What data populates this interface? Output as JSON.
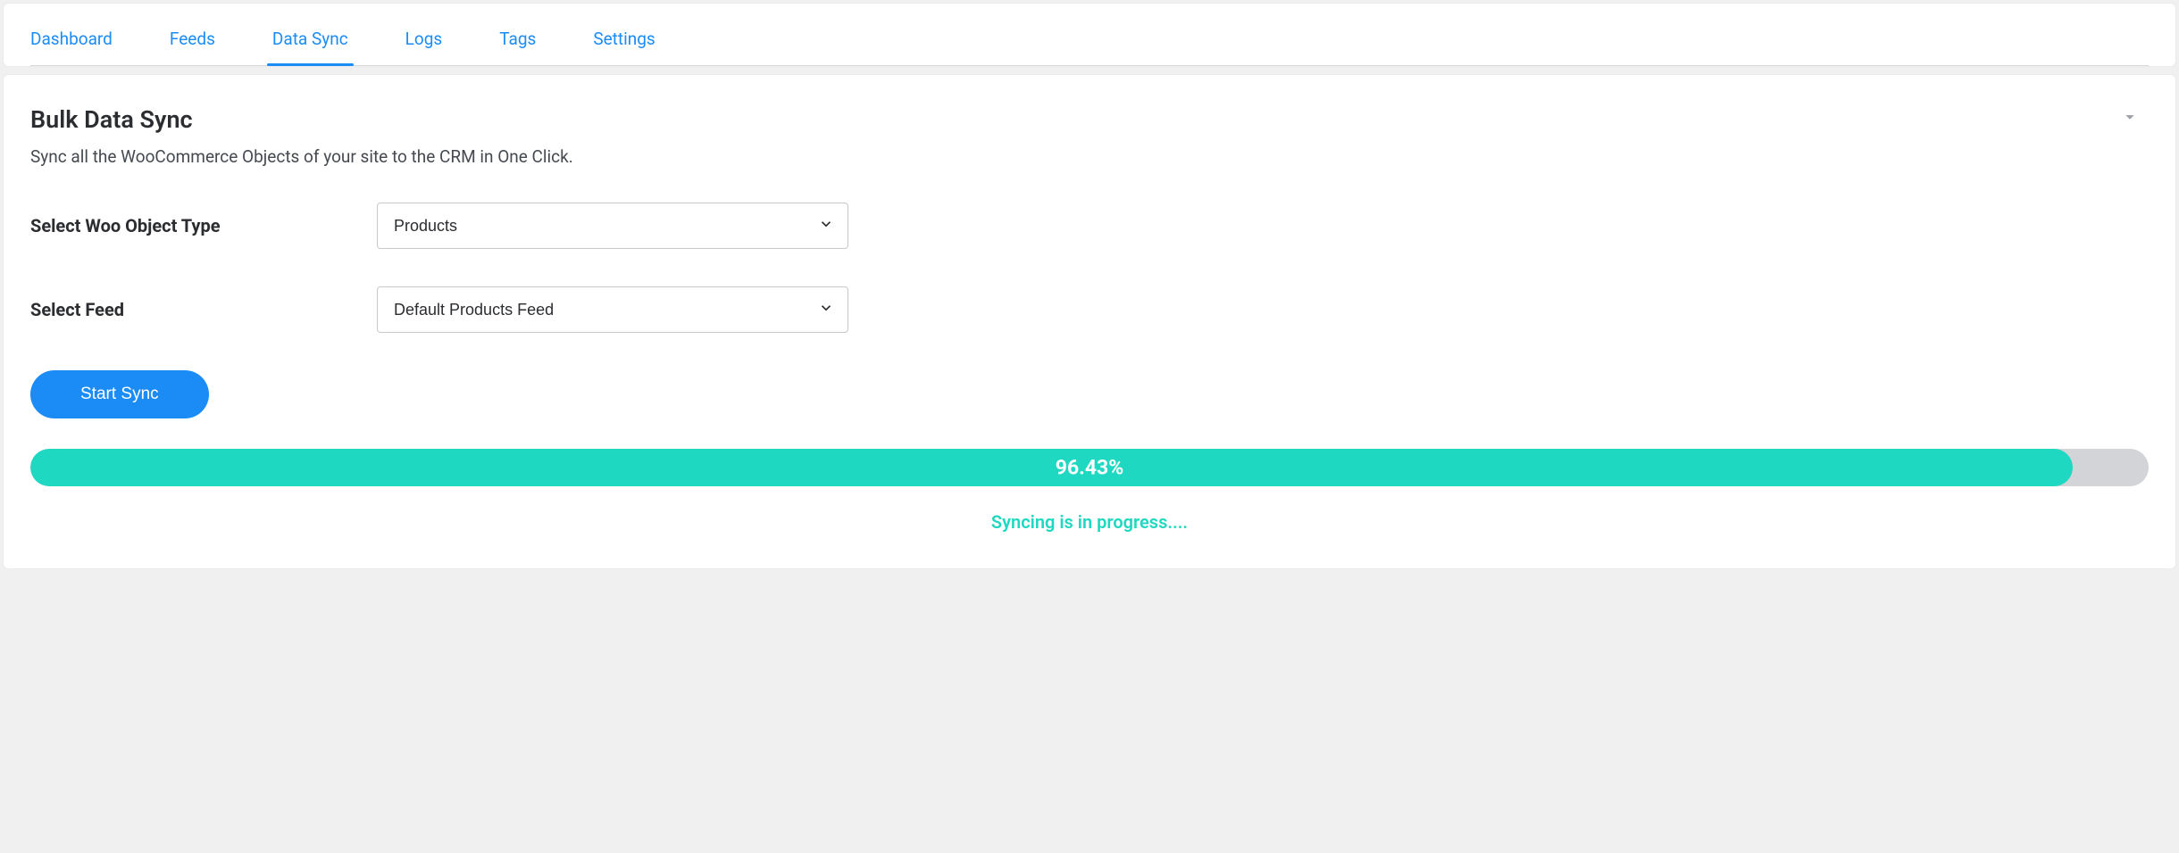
{
  "tabs": {
    "items": [
      {
        "label": "Dashboard",
        "active": false
      },
      {
        "label": "Feeds",
        "active": false
      },
      {
        "label": "Data Sync",
        "active": true
      },
      {
        "label": "Logs",
        "active": false
      },
      {
        "label": "Tags",
        "active": false
      },
      {
        "label": "Settings",
        "active": false
      }
    ]
  },
  "page": {
    "title": "Bulk Data Sync",
    "subtitle": "Sync all the WooCommerce Objects of your site to the CRM in One Click."
  },
  "form": {
    "object_type_label": "Select Woo Object Type",
    "object_type_value": "Products",
    "feed_label": "Select Feed",
    "feed_value": "Default Products Feed",
    "start_button_label": "Start Sync"
  },
  "progress": {
    "percent": 96.43,
    "percent_display": "96.43%",
    "status_text": "Syncing is in progress...."
  },
  "colors": {
    "accent_blue": "#1b8cf6",
    "accent_teal": "#1ed8c1",
    "track_gray": "#d2d4d8"
  }
}
